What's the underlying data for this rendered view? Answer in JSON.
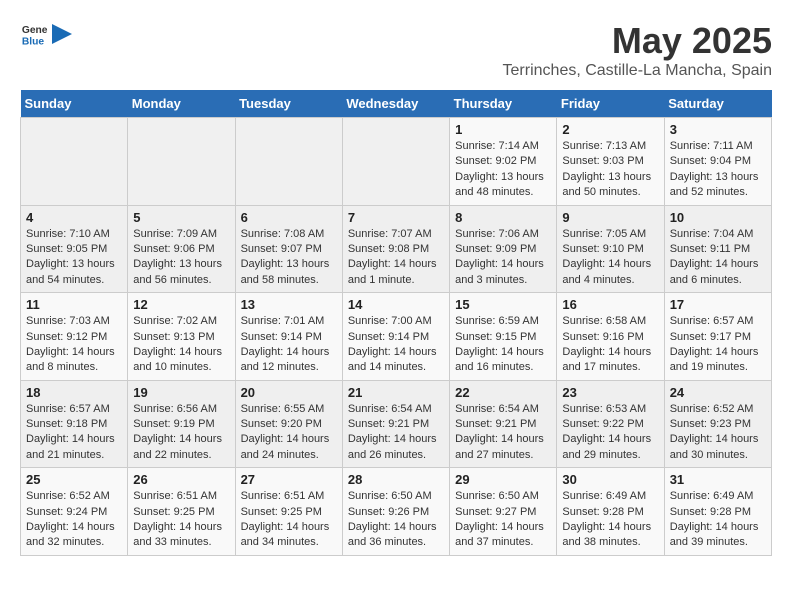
{
  "logo": {
    "text_general": "General",
    "text_blue": "Blue"
  },
  "title": {
    "month": "May 2025",
    "location": "Terrinches, Castille-La Mancha, Spain"
  },
  "days_of_week": [
    "Sunday",
    "Monday",
    "Tuesday",
    "Wednesday",
    "Thursday",
    "Friday",
    "Saturday"
  ],
  "weeks": [
    [
      {
        "day": "",
        "empty": true
      },
      {
        "day": "",
        "empty": true
      },
      {
        "day": "",
        "empty": true
      },
      {
        "day": "",
        "empty": true
      },
      {
        "day": "1",
        "sunrise": "7:14 AM",
        "sunset": "9:02 PM",
        "daylight": "13 hours and 48 minutes."
      },
      {
        "day": "2",
        "sunrise": "7:13 AM",
        "sunset": "9:03 PM",
        "daylight": "13 hours and 50 minutes."
      },
      {
        "day": "3",
        "sunrise": "7:11 AM",
        "sunset": "9:04 PM",
        "daylight": "13 hours and 52 minutes."
      }
    ],
    [
      {
        "day": "4",
        "sunrise": "7:10 AM",
        "sunset": "9:05 PM",
        "daylight": "13 hours and 54 minutes."
      },
      {
        "day": "5",
        "sunrise": "7:09 AM",
        "sunset": "9:06 PM",
        "daylight": "13 hours and 56 minutes."
      },
      {
        "day": "6",
        "sunrise": "7:08 AM",
        "sunset": "9:07 PM",
        "daylight": "13 hours and 58 minutes."
      },
      {
        "day": "7",
        "sunrise": "7:07 AM",
        "sunset": "9:08 PM",
        "daylight": "14 hours and 1 minute."
      },
      {
        "day": "8",
        "sunrise": "7:06 AM",
        "sunset": "9:09 PM",
        "daylight": "14 hours and 3 minutes."
      },
      {
        "day": "9",
        "sunrise": "7:05 AM",
        "sunset": "9:10 PM",
        "daylight": "14 hours and 4 minutes."
      },
      {
        "day": "10",
        "sunrise": "7:04 AM",
        "sunset": "9:11 PM",
        "daylight": "14 hours and 6 minutes."
      }
    ],
    [
      {
        "day": "11",
        "sunrise": "7:03 AM",
        "sunset": "9:12 PM",
        "daylight": "14 hours and 8 minutes."
      },
      {
        "day": "12",
        "sunrise": "7:02 AM",
        "sunset": "9:13 PM",
        "daylight": "14 hours and 10 minutes."
      },
      {
        "day": "13",
        "sunrise": "7:01 AM",
        "sunset": "9:14 PM",
        "daylight": "14 hours and 12 minutes."
      },
      {
        "day": "14",
        "sunrise": "7:00 AM",
        "sunset": "9:14 PM",
        "daylight": "14 hours and 14 minutes."
      },
      {
        "day": "15",
        "sunrise": "6:59 AM",
        "sunset": "9:15 PM",
        "daylight": "14 hours and 16 minutes."
      },
      {
        "day": "16",
        "sunrise": "6:58 AM",
        "sunset": "9:16 PM",
        "daylight": "14 hours and 17 minutes."
      },
      {
        "day": "17",
        "sunrise": "6:57 AM",
        "sunset": "9:17 PM",
        "daylight": "14 hours and 19 minutes."
      }
    ],
    [
      {
        "day": "18",
        "sunrise": "6:57 AM",
        "sunset": "9:18 PM",
        "daylight": "14 hours and 21 minutes."
      },
      {
        "day": "19",
        "sunrise": "6:56 AM",
        "sunset": "9:19 PM",
        "daylight": "14 hours and 22 minutes."
      },
      {
        "day": "20",
        "sunrise": "6:55 AM",
        "sunset": "9:20 PM",
        "daylight": "14 hours and 24 minutes."
      },
      {
        "day": "21",
        "sunrise": "6:54 AM",
        "sunset": "9:21 PM",
        "daylight": "14 hours and 26 minutes."
      },
      {
        "day": "22",
        "sunrise": "6:54 AM",
        "sunset": "9:21 PM",
        "daylight": "14 hours and 27 minutes."
      },
      {
        "day": "23",
        "sunrise": "6:53 AM",
        "sunset": "9:22 PM",
        "daylight": "14 hours and 29 minutes."
      },
      {
        "day": "24",
        "sunrise": "6:52 AM",
        "sunset": "9:23 PM",
        "daylight": "14 hours and 30 minutes."
      }
    ],
    [
      {
        "day": "25",
        "sunrise": "6:52 AM",
        "sunset": "9:24 PM",
        "daylight": "14 hours and 32 minutes."
      },
      {
        "day": "26",
        "sunrise": "6:51 AM",
        "sunset": "9:25 PM",
        "daylight": "14 hours and 33 minutes."
      },
      {
        "day": "27",
        "sunrise": "6:51 AM",
        "sunset": "9:25 PM",
        "daylight": "14 hours and 34 minutes."
      },
      {
        "day": "28",
        "sunrise": "6:50 AM",
        "sunset": "9:26 PM",
        "daylight": "14 hours and 36 minutes."
      },
      {
        "day": "29",
        "sunrise": "6:50 AM",
        "sunset": "9:27 PM",
        "daylight": "14 hours and 37 minutes."
      },
      {
        "day": "30",
        "sunrise": "6:49 AM",
        "sunset": "9:28 PM",
        "daylight": "14 hours and 38 minutes."
      },
      {
        "day": "31",
        "sunrise": "6:49 AM",
        "sunset": "9:28 PM",
        "daylight": "14 hours and 39 minutes."
      }
    ]
  ]
}
